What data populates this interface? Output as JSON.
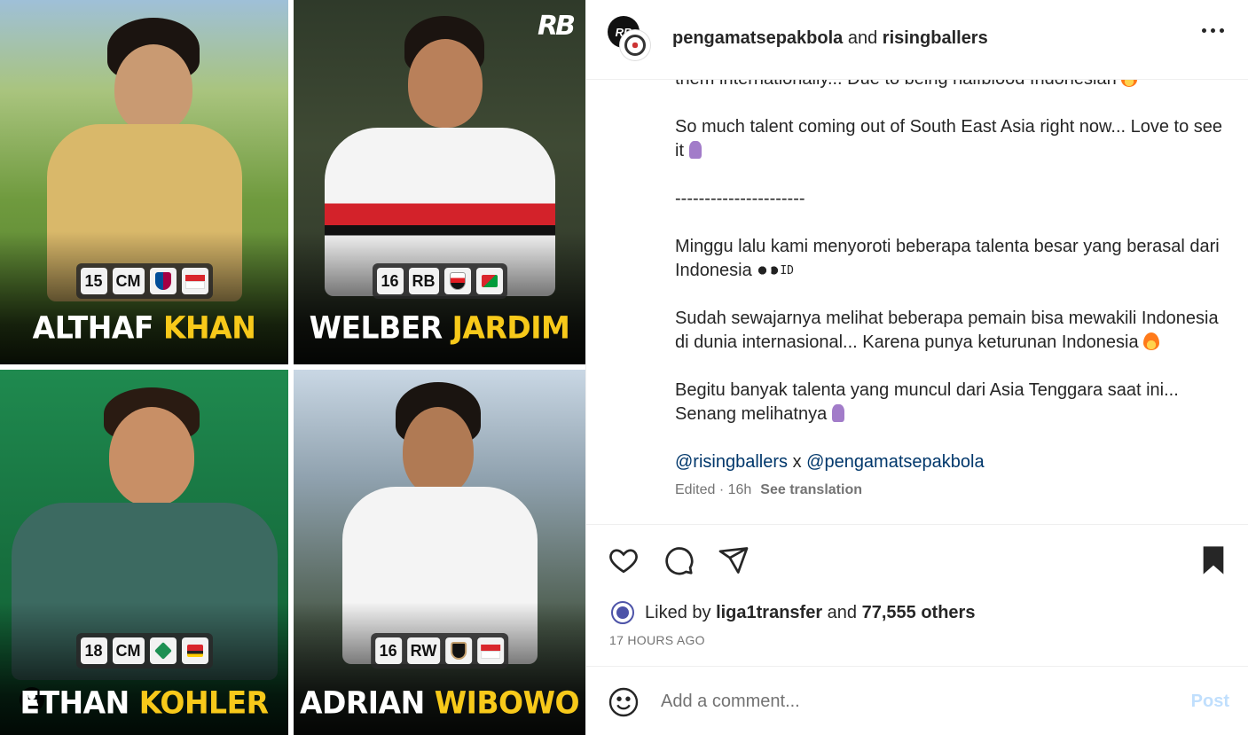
{
  "header": {
    "user1": "pengamatsepakbola",
    "conjunction": " and ",
    "user2": "risingballers",
    "avatar_label": "RB"
  },
  "media": {
    "logo": "RB",
    "players": [
      {
        "first": "ALTHAF",
        "last": "KHAN",
        "age": "15",
        "pos": "CM",
        "club_color": "#a50044",
        "nation_colors": [
          "#d9262c",
          "#ffffff"
        ]
      },
      {
        "first": "WELBER",
        "last": "JARDIM",
        "age": "16",
        "pos": "RB",
        "club_color": "#e21c23",
        "nation_colors": [
          "#d9262c",
          "#009c3b"
        ]
      },
      {
        "first": "ETHAN",
        "last": "KOHLER",
        "age": "18",
        "pos": "CM",
        "club_color": "#1d9053",
        "nation_colors": [
          "#d9262c",
          "#ffce00"
        ]
      },
      {
        "first": "ADRIAN",
        "last": "WIBOWO",
        "age": "16",
        "pos": "RW",
        "club_color": "#c39e6d",
        "nation_colors": [
          "#d9262c",
          "#ffffff"
        ]
      }
    ]
  },
  "caption": {
    "partial_line": "them internationally... Due to being halfblood Indonesian",
    "p1": "So much talent coming out of South East Asia right now... Love to see it",
    "divider": "----------------------",
    "p2": "Minggu lalu kami menyoroti beberapa talenta besar yang berasal dari Indonesia",
    "id_tag": "ID",
    "p3": "Sudah sewajarnya melihat beberapa pemain bisa mewakili Indonesia di dunia internasional... Karena punya keturunan Indonesia",
    "p4": "Begitu banyak talenta yang muncul dari Asia Tenggara saat ini... Senang melihatnya",
    "mention1": "@risingballers",
    "mention_sep": " x ",
    "mention2": "@pengamatsepakbola",
    "meta": "Edited · 16h",
    "see_translation": "See translation"
  },
  "actions": {
    "liked_by_prefix": "Liked by ",
    "liked_by_user": "liga1transfer",
    "liked_by_and": " and ",
    "liked_by_count": "77,555 others",
    "time": "17 HOURS AGO"
  },
  "comment": {
    "placeholder": "Add a comment...",
    "post_label": "Post"
  },
  "colors": {
    "link": "#00376b",
    "muted": "#737373",
    "post_disabled": "#c0dffd",
    "name_highlight": "#f7c91a"
  }
}
